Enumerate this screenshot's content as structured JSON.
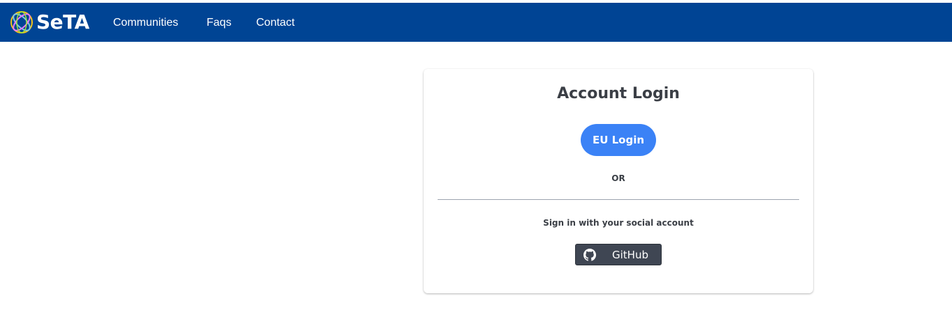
{
  "navbar": {
    "brand_name": "SeTA",
    "background_color": "#004494",
    "links": [
      {
        "label": "Communities"
      },
      {
        "label": "Faqs"
      },
      {
        "label": "Contact"
      }
    ]
  },
  "login_card": {
    "title": "Account Login",
    "eu_login_label": "EU Login",
    "eu_login_color": "#3b82f6",
    "separator_text": "OR",
    "social_prompt": "Sign in with your social account",
    "github_label": "GitHub",
    "github_icon": "github-icon"
  }
}
